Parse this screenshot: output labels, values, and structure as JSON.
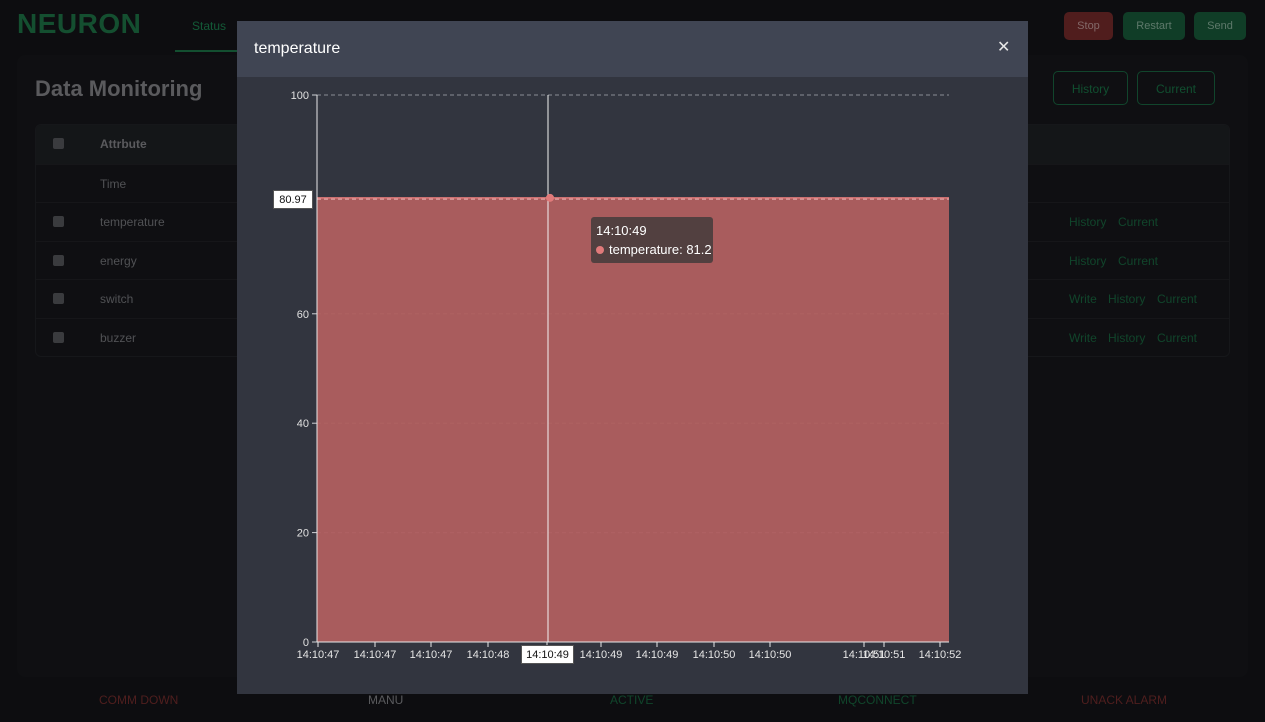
{
  "app": {
    "logo": "NEURON",
    "nav_tab": "Status",
    "stop": "Stop",
    "restart": "Restart",
    "send": "Send"
  },
  "page": {
    "title": "Data Monitoring",
    "history_btn": "History",
    "current_btn": "Current"
  },
  "table": {
    "header": "Attrbute",
    "time_label": "Time",
    "rows": [
      {
        "name": "temperature",
        "actions": [
          "History",
          "Current"
        ]
      },
      {
        "name": "energy",
        "actions": [
          "History",
          "Current"
        ]
      },
      {
        "name": "switch",
        "actions": [
          "Write",
          "History",
          "Current"
        ]
      },
      {
        "name": "buzzer",
        "actions": [
          "Write",
          "History",
          "Current"
        ]
      }
    ]
  },
  "footer": {
    "comm_down": "COMM DOWN",
    "manu": "MANU",
    "active": "ACTIVE",
    "mqconnect": "MQCONNECT",
    "unack_alarm": "UNACK ALARM"
  },
  "modal": {
    "title": "temperature",
    "close_icon": "close-icon"
  },
  "colors": {
    "accent_green": "#1f7a4a",
    "danger_red": "#7b2d2d",
    "series_fill": "#b05f5f",
    "series_line": "#e07a7a"
  },
  "chart_data": {
    "type": "area",
    "x": [
      "14:10:47",
      "14:10:47",
      "14:10:47",
      "14:10:48",
      "14:10:49",
      "14:10:49",
      "14:10:49",
      "14:10:50",
      "14:10:50",
      "14:10:51",
      "14:10:51",
      "14:10:52"
    ],
    "series": [
      {
        "name": "temperature",
        "values": [
          81.2,
          81.2,
          81.2,
          81.2,
          81.2,
          81.2,
          81.2,
          81.2,
          81.2,
          81.2,
          81.2,
          81.2
        ]
      }
    ],
    "ylim": [
      0,
      100
    ],
    "yticks": [
      0,
      20,
      40,
      60,
      100
    ],
    "grid": true,
    "crosshair": {
      "x_label": "14:10:49",
      "y_label": "80.97"
    },
    "tooltip": {
      "time": "14:10:49",
      "text": "temperature: 81.2"
    }
  }
}
